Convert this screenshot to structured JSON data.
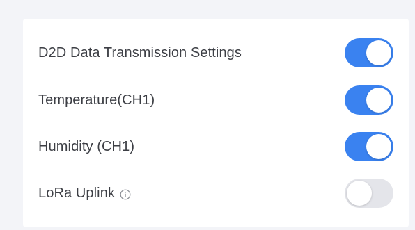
{
  "settings": {
    "items": [
      {
        "label": "D2D Data Transmission Settings",
        "enabled": true,
        "has_info": false
      },
      {
        "label": "Temperature(CH1)",
        "enabled": true,
        "has_info": false
      },
      {
        "label": "Humidity (CH1)",
        "enabled": true,
        "has_info": false
      },
      {
        "label": "LoRa Uplink",
        "enabled": false,
        "has_info": true,
        "info_icon": "info-circle-icon"
      }
    ]
  },
  "colors": {
    "toggle_on": "#3a82f0",
    "toggle_off": "#e4e5ea",
    "background": "#f3f4f8",
    "card": "#ffffff",
    "text": "#3d3f45"
  }
}
